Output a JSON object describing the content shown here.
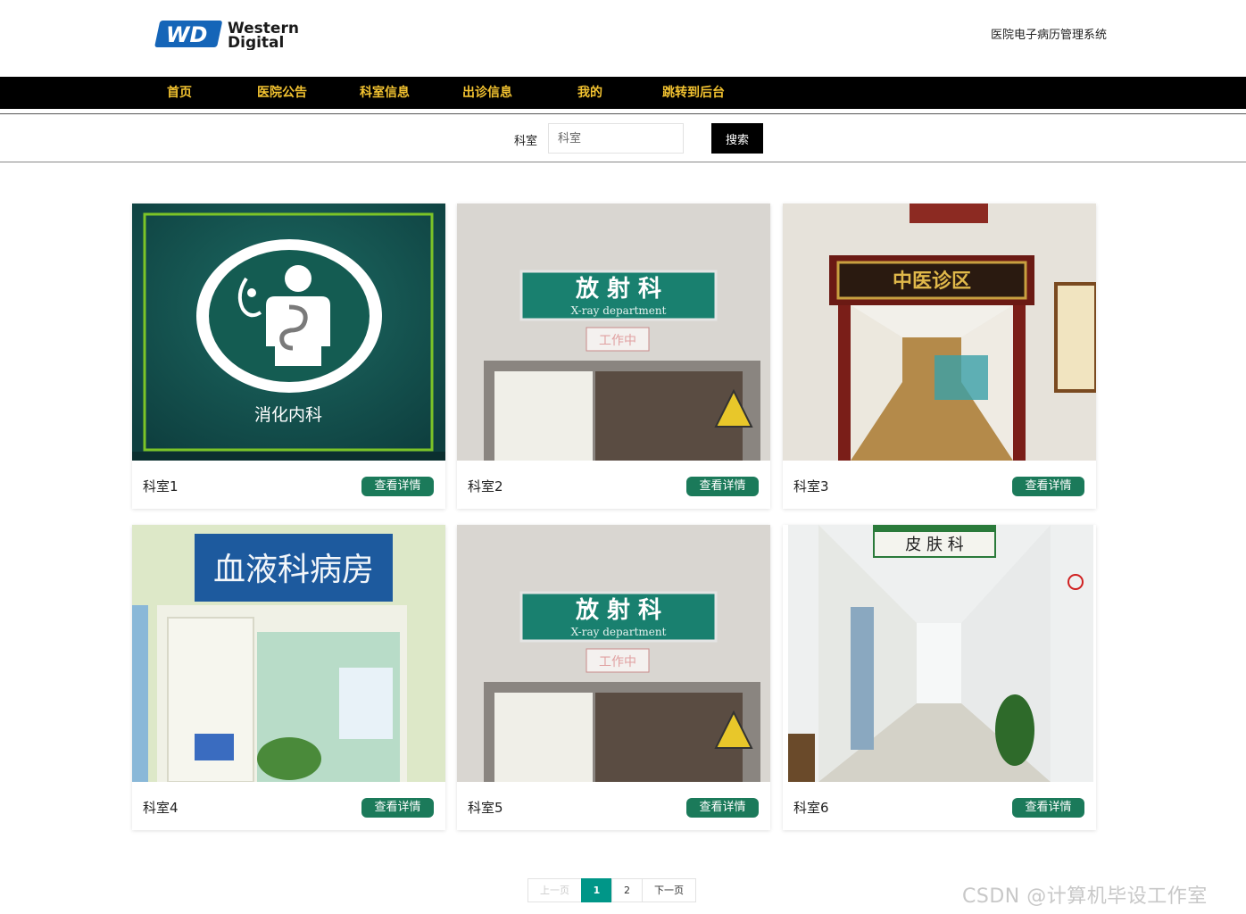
{
  "header": {
    "logo_line1": "Western",
    "logo_line2": "Digital",
    "logo_mark": "WD",
    "site_title": "医院电子病历管理系统"
  },
  "nav": {
    "items": [
      {
        "label": "首页"
      },
      {
        "label": "医院公告"
      },
      {
        "label": "科室信息"
      },
      {
        "label": "出诊信息"
      },
      {
        "label": "我的"
      },
      {
        "label": "跳转到后台"
      }
    ]
  },
  "search": {
    "label": "科室",
    "placeholder": "科室",
    "button_label": "搜索"
  },
  "cards": [
    {
      "name": "科室1",
      "button_label": "查看详情",
      "image_text": "消化内科"
    },
    {
      "name": "科室2",
      "button_label": "查看详情",
      "image_text": "放 射 科",
      "image_subtext": "X-ray department",
      "image_tag": "工作中"
    },
    {
      "name": "科室3",
      "button_label": "查看详情",
      "image_text": "中医诊区"
    },
    {
      "name": "科室4",
      "button_label": "查看详情",
      "image_text": "血液科病房"
    },
    {
      "name": "科室5",
      "button_label": "查看详情",
      "image_text": "放 射 科",
      "image_subtext": "X-ray department",
      "image_tag": "工作中"
    },
    {
      "name": "科室6",
      "button_label": "查看详情",
      "image_text": "皮 肤 科"
    }
  ],
  "pagination": {
    "prev": "上一页",
    "pages": [
      "1",
      "2"
    ],
    "current": "1",
    "next": "下一页"
  },
  "watermark": "CSDN @计算机毕设工作室",
  "colors": {
    "nav_bg": "#000000",
    "nav_text": "#f2c230",
    "button_green": "#1b7a5a",
    "pager_active": "#009688"
  }
}
